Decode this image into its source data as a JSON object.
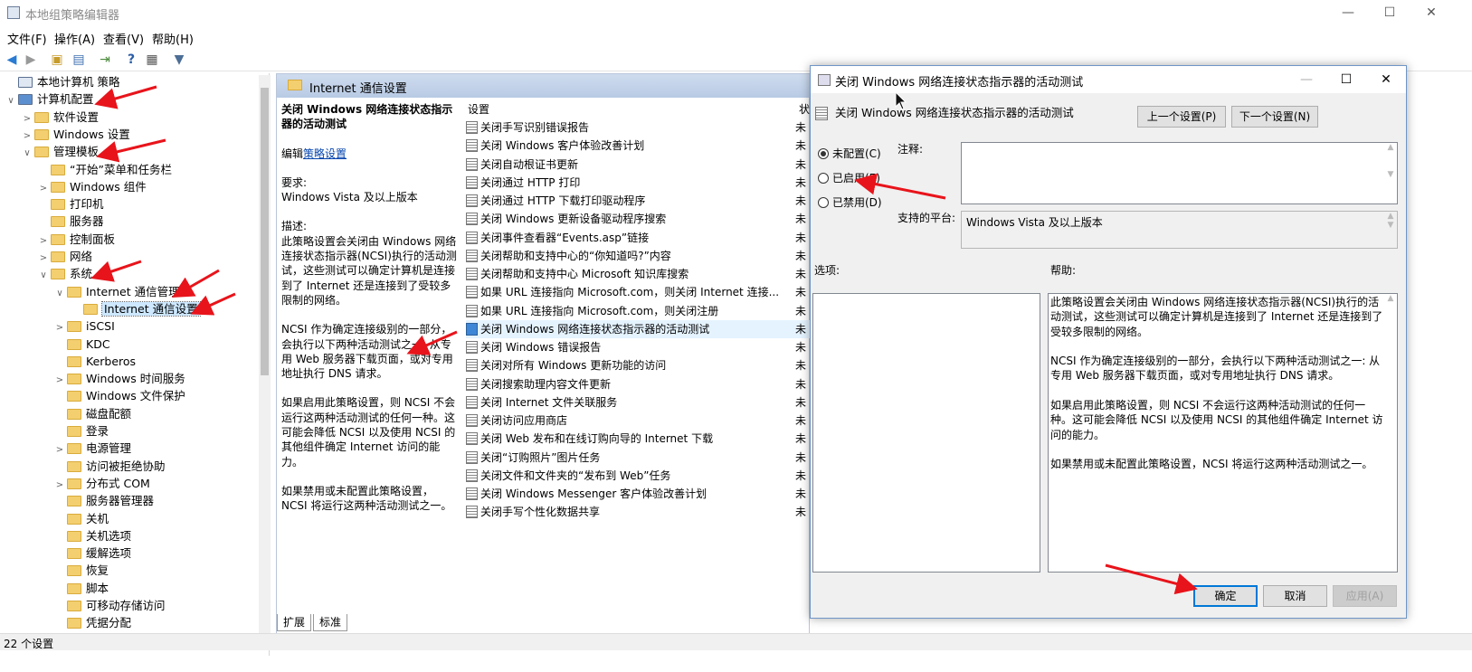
{
  "window": {
    "title": "本地组策略编辑器",
    "minimize": "—",
    "maximize": "☐",
    "close": "✕"
  },
  "menu": [
    "文件(F)",
    "操作(A)",
    "查看(V)",
    "帮助(H)"
  ],
  "toolbar_icons": [
    "back-icon",
    "forward-icon",
    "up-folder-icon",
    "show-hide-tree-icon",
    "export-list-icon",
    "help-icon",
    "properties-icon",
    "filter-icon"
  ],
  "tree": [
    {
      "label": "本地计算机 策略",
      "depth": 0,
      "arrow": "",
      "folder": false
    },
    {
      "label": "计算机配置",
      "depth": 0,
      "arrow": "∨",
      "folder": false,
      "computer": true
    },
    {
      "label": "软件设置",
      "depth": 1,
      "arrow": ">",
      "folder": true
    },
    {
      "label": "Windows 设置",
      "depth": 1,
      "arrow": ">",
      "folder": true
    },
    {
      "label": "管理模板",
      "depth": 1,
      "arrow": "∨",
      "folder": true
    },
    {
      "label": "“开始”菜单和任务栏",
      "depth": 2,
      "arrow": "",
      "folder": true
    },
    {
      "label": "Windows 组件",
      "depth": 2,
      "arrow": ">",
      "folder": true
    },
    {
      "label": "打印机",
      "depth": 2,
      "arrow": "",
      "folder": true
    },
    {
      "label": "服务器",
      "depth": 2,
      "arrow": "",
      "folder": true
    },
    {
      "label": "控制面板",
      "depth": 2,
      "arrow": ">",
      "folder": true
    },
    {
      "label": "网络",
      "depth": 2,
      "arrow": ">",
      "folder": true
    },
    {
      "label": "系统",
      "depth": 2,
      "arrow": "∨",
      "folder": true
    },
    {
      "label": "Internet 通信管理",
      "depth": 3,
      "arrow": "∨",
      "folder": true
    },
    {
      "label": "Internet 通信设置",
      "depth": 4,
      "arrow": "",
      "folder": true,
      "selected": true
    },
    {
      "label": "iSCSI",
      "depth": 3,
      "arrow": ">",
      "folder": true
    },
    {
      "label": "KDC",
      "depth": 3,
      "arrow": "",
      "folder": true
    },
    {
      "label": "Kerberos",
      "depth": 3,
      "arrow": "",
      "folder": true
    },
    {
      "label": "Windows 时间服务",
      "depth": 3,
      "arrow": ">",
      "folder": true
    },
    {
      "label": "Windows 文件保护",
      "depth": 3,
      "arrow": "",
      "folder": true
    },
    {
      "label": "磁盘配额",
      "depth": 3,
      "arrow": "",
      "folder": true
    },
    {
      "label": "登录",
      "depth": 3,
      "arrow": "",
      "folder": true
    },
    {
      "label": "电源管理",
      "depth": 3,
      "arrow": ">",
      "folder": true
    },
    {
      "label": "访问被拒绝协助",
      "depth": 3,
      "arrow": "",
      "folder": true
    },
    {
      "label": "分布式 COM",
      "depth": 3,
      "arrow": ">",
      "folder": true
    },
    {
      "label": "服务器管理器",
      "depth": 3,
      "arrow": "",
      "folder": true
    },
    {
      "label": "关机",
      "depth": 3,
      "arrow": "",
      "folder": true
    },
    {
      "label": "关机选项",
      "depth": 3,
      "arrow": "",
      "folder": true
    },
    {
      "label": "缓解选项",
      "depth": 3,
      "arrow": "",
      "folder": true
    },
    {
      "label": "恢复",
      "depth": 3,
      "arrow": "",
      "folder": true
    },
    {
      "label": "脚本",
      "depth": 3,
      "arrow": "",
      "folder": true
    },
    {
      "label": "可移动存储访问",
      "depth": 3,
      "arrow": "",
      "folder": true
    },
    {
      "label": "凭据分配",
      "depth": 3,
      "arrow": "",
      "folder": true
    }
  ],
  "middle": {
    "header": "Internet 通信设置",
    "desc_title": "关闭 Windows 网络连接状态指示器的活动测试",
    "edit_prefix": "编辑",
    "edit_link": "策略设置",
    "req_label": "要求:",
    "req_value": "Windows Vista 及以上版本",
    "desc_label": "描述:",
    "desc_p1": "此策略设置会关闭由 Windows 网络连接状态指示器(NCSI)执行的活动测试，这些测试可以确定计算机是连接到了 Internet 还是连接到了受较多限制的网络。",
    "desc_p2": "NCSI 作为确定连接级别的一部分，会执行以下两种活动测试之一: 从专用 Web 服务器下载页面，或对专用地址执行 DNS 请求。",
    "desc_p3": "如果启用此策略设置，则 NCSI 不会运行这两种活动测试的任何一种。这可能会降低 NCSI 以及使用 NCSI 的其他组件确定 Internet 访问的能力。",
    "desc_p4": "如果禁用或未配置此策略设置，NCSI 将运行这两种活动测试之一。",
    "col_setting": "设置",
    "col_state": "状",
    "settings": [
      "关闭手写识别错误报告",
      "关闭 Windows 客户体验改善计划",
      "关闭自动根证书更新",
      "关闭通过 HTTP 打印",
      "关闭通过 HTTP 下载打印驱动程序",
      "关闭 Windows 更新设备驱动程序搜索",
      "关闭事件查看器“Events.asp”链接",
      "关闭帮助和支持中心的“你知道吗?”内容",
      "关闭帮助和支持中心 Microsoft 知识库搜索",
      "如果 URL 连接指向 Microsoft.com，则关闭 Internet 连接...",
      "如果 URL 连接指向 Microsoft.com，则关闭注册",
      "关闭 Windows 网络连接状态指示器的活动测试",
      "关闭 Windows 错误报告",
      "关闭对所有 Windows 更新功能的访问",
      "关闭搜索助理内容文件更新",
      "关闭 Internet 文件关联服务",
      "关闭访问应用商店",
      "关闭 Web 发布和在线订购向导的 Internet 下载",
      "关闭“订购照片”图片任务",
      "关闭文件和文件夹的“发布到 Web”任务",
      "关闭 Windows Messenger 客户体验改善计划",
      "关闭手写个性化数据共享"
    ],
    "state_value": "未",
    "highlighted_index": 11,
    "tabs": [
      "扩展",
      "标准"
    ]
  },
  "status": "22 个设置",
  "dialog": {
    "title": "关闭 Windows 网络连接状态指示器的活动测试",
    "header_title": "关闭 Windows 网络连接状态指示器的活动测试",
    "prev_btn": "上一个设置(P)",
    "next_btn": "下一个设置(N)",
    "radio_notconfig": "未配置(C)",
    "radio_enabled": "已启用(E)",
    "radio_disabled": "已禁用(D)",
    "comment_label": "注释:",
    "platform_label": "支持的平台:",
    "platform_value": "Windows Vista 及以上版本",
    "options_label": "选项:",
    "help_label": "帮助:",
    "help_p1": "此策略设置会关闭由 Windows 网络连接状态指示器(NCSI)执行的活动测试，这些测试可以确定计算机是连接到了 Internet 还是连接到了受较多限制的网络。",
    "help_p2": "NCSI 作为确定连接级别的一部分，会执行以下两种活动测试之一: 从专用 Web 服务器下载页面，或对专用地址执行 DNS 请求。",
    "help_p3": "如果启用此策略设置，则 NCSI 不会运行这两种活动测试的任何一种。这可能会降低 NCSI 以及使用 NCSI 的其他组件确定 Internet 访问的能力。",
    "help_p4": "如果禁用或未配置此策略设置，NCSI 将运行这两种活动测试之一。",
    "ok": "确定",
    "cancel": "取消",
    "apply": "应用(A)"
  },
  "colors": {
    "annotation_arrow": "#e8141b",
    "highlight_row": "#e5f3ff",
    "header_gradient": "#c4d4eb"
  }
}
